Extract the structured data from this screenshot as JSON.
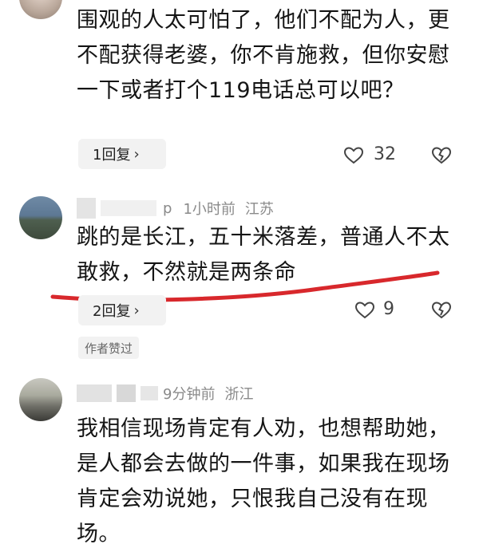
{
  "comments": [
    {
      "text": "围观的人太可怕了，他们不配为人，更不配获得老婆，你不肯施救，但你安慰一下或者打个119电话总可以吧？",
      "reply_label": "1回复",
      "like_count": "32"
    },
    {
      "user_name_tail": "p",
      "time": "1小时前",
      "location": "江苏",
      "text": "跳的是长江，五十米落差，普通人不太敢救，不然就是两条命",
      "reply_label": "2回复",
      "like_count": "9",
      "author_liked": "作者赞过"
    },
    {
      "time": "9分钟前",
      "location": "浙江",
      "text": "我相信现场肯定有人劝，也想帮助她，是人都会去做的一件事，如果我在现场肯定会劝说她，只恨我自己没有在现场。"
    }
  ],
  "icons": {
    "chevron": "chevron-right-icon",
    "like": "heart-icon",
    "dislike": "broken-heart-icon"
  },
  "colors": {
    "annotation_red": "#d8282c",
    "pill_bg": "#f2f2f2",
    "meta_gray": "#8a8a8a"
  }
}
